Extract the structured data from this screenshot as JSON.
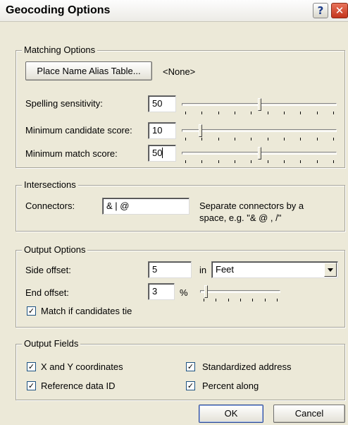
{
  "window": {
    "title": "Geocoding Options",
    "help_glyph": "?",
    "close_glyph": "✕"
  },
  "matching": {
    "title": "Matching Options",
    "alias_button": "Place Name Alias Table...",
    "alias_value": "<None>",
    "rows": [
      {
        "label": "Spelling sensitivity:",
        "value": "50",
        "level": 0.5
      },
      {
        "label": "Minimum candidate score:",
        "value": "10",
        "level": 0.1
      },
      {
        "label": "Minimum match score:",
        "value": "50",
        "level": 0.5
      }
    ]
  },
  "intersections": {
    "title": "Intersections",
    "connectors_label": "Connectors:",
    "connectors_value": "& | @",
    "help_line1": "Separate connectors by a",
    "help_line2": "space, e.g. \"& @ , /\""
  },
  "output_options": {
    "title": "Output Options",
    "side_offset_label": "Side offset:",
    "side_offset_value": "5",
    "in_label": "in",
    "units_value": "Feet",
    "end_offset_label": "End offset:",
    "end_offset_value": "3",
    "percent_label": "%",
    "end_offset_level": 0.03,
    "tie_label": "Match if candidates tie",
    "tie_checked": true
  },
  "output_fields": {
    "title": "Output Fields",
    "xy_label": "X and Y coordinates",
    "ref_label": "Reference data ID",
    "std_label": "Standardized address",
    "pct_label": "Percent along",
    "checked": true
  },
  "buttons": {
    "ok": "OK",
    "cancel": "Cancel"
  },
  "check_glyph": "✓",
  "colors": {
    "dialog_bg": "#ece9d8",
    "close_red": "#c3341b"
  }
}
